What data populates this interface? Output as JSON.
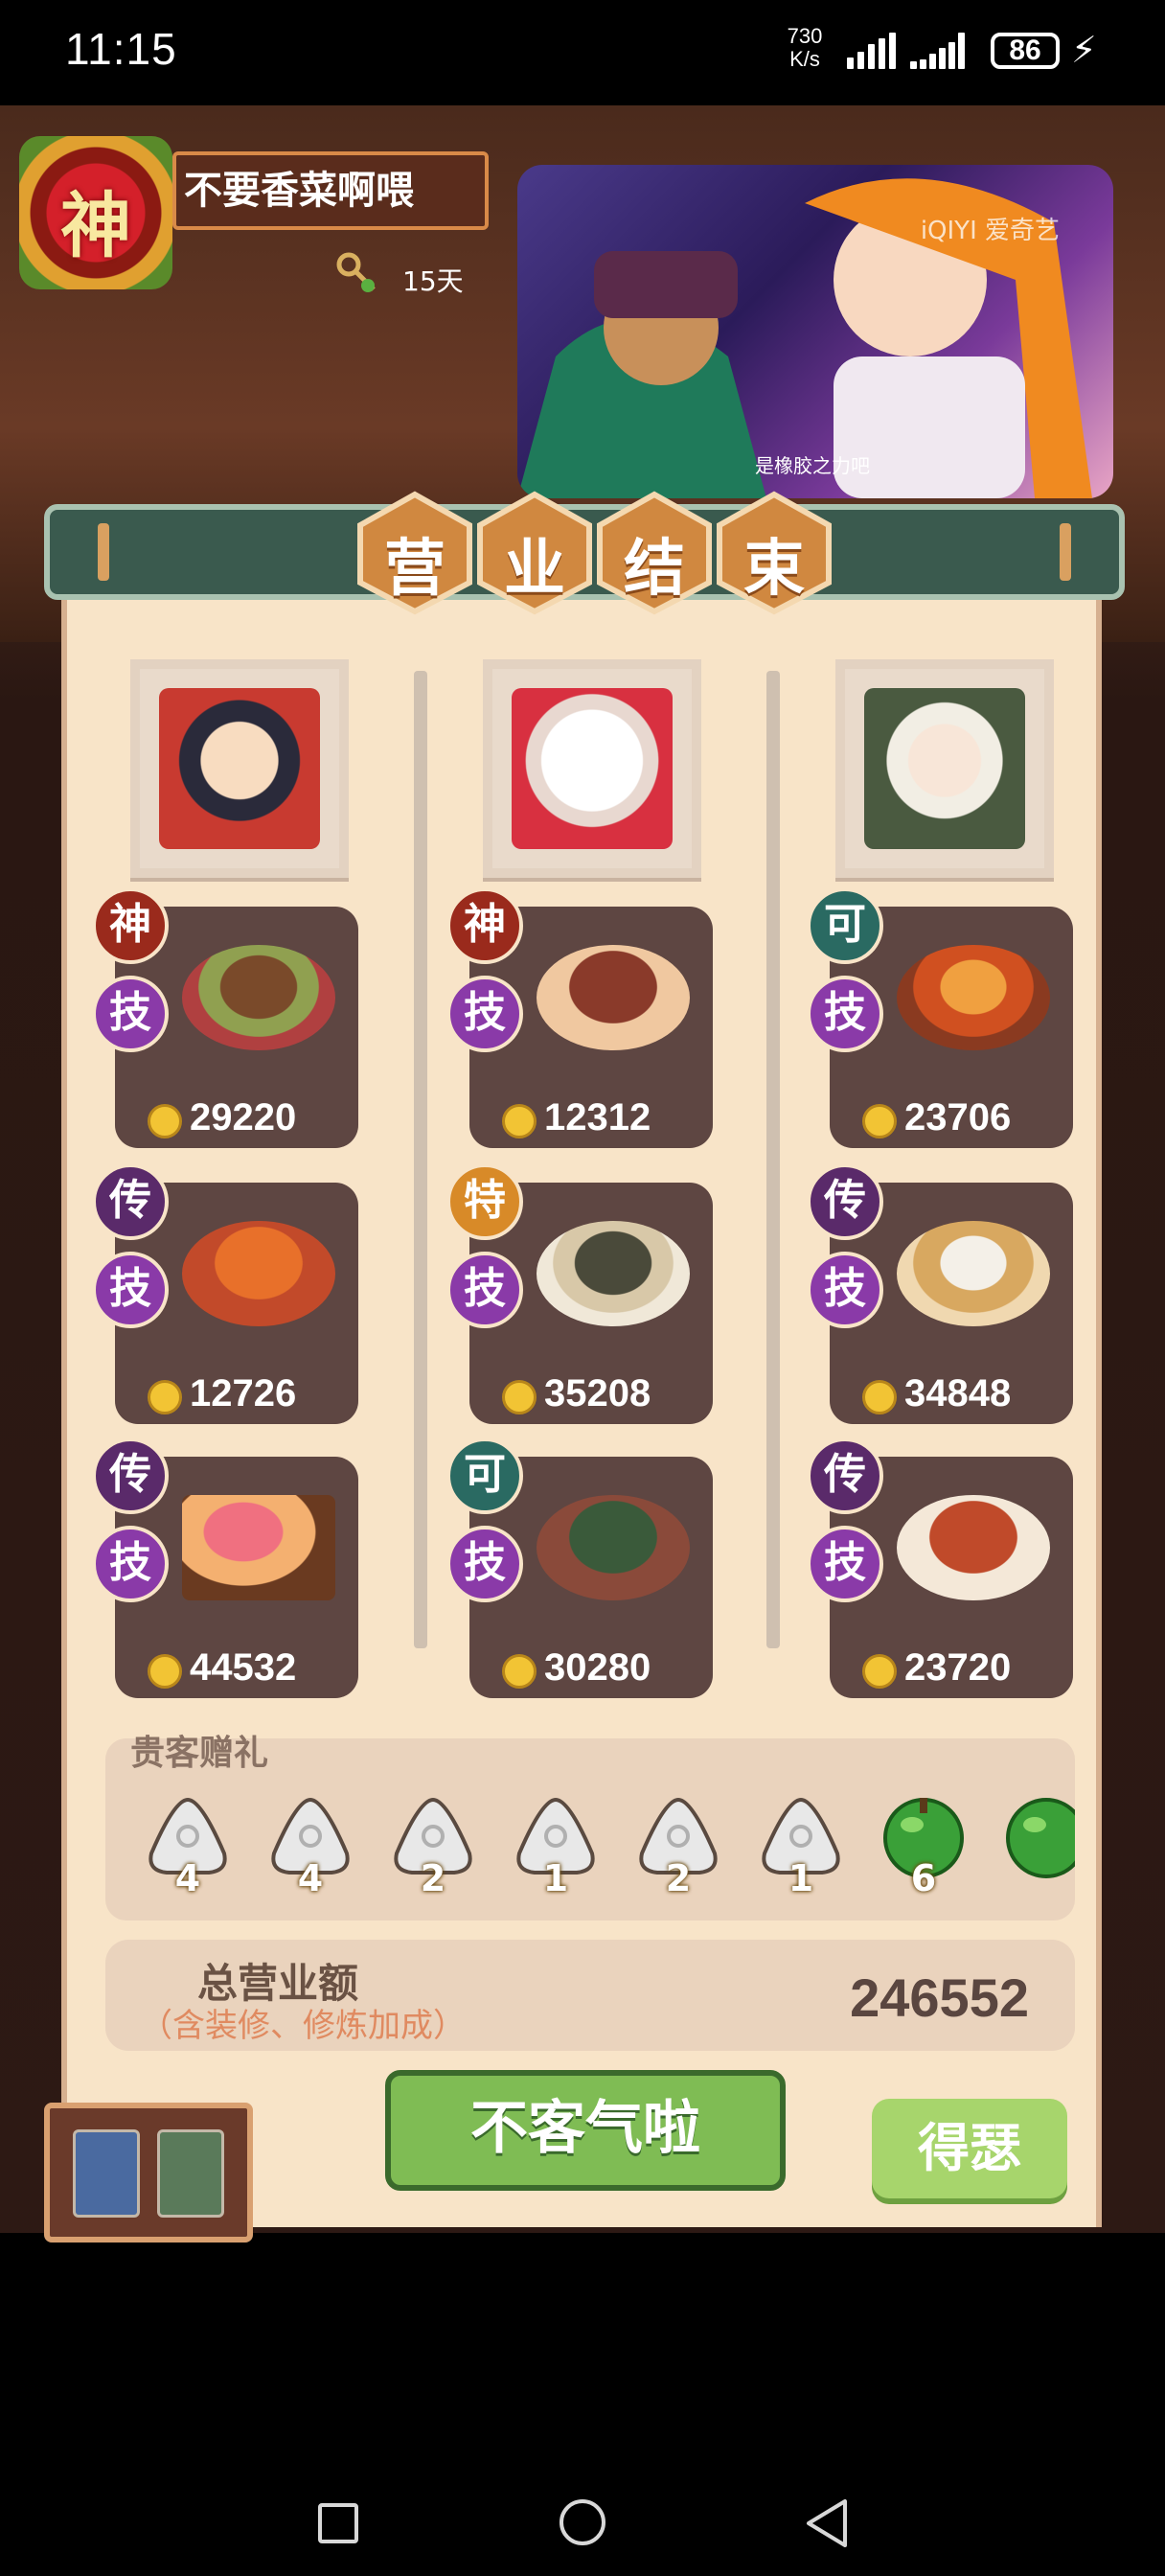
{
  "status_bar": {
    "time": "11:15",
    "net_speed_value": "730",
    "net_speed_unit": "K/s",
    "battery": "86"
  },
  "player": {
    "rank_badge": "神",
    "name": "不要香菜啊喂",
    "days": "15天"
  },
  "video": {
    "watermark": "iQIYI 爱奇艺",
    "subtitle": "是橡胶之力吧"
  },
  "banner": {
    "chars": [
      "营",
      "业",
      "结",
      "束"
    ]
  },
  "guests": [
    {
      "icon": "chef-boy-portrait",
      "dishes": [
        {
          "grade": "神",
          "skill": "技",
          "coins": "29220"
        },
        {
          "grade": "传",
          "skill": "技",
          "coins": "12726"
        },
        {
          "grade": "传",
          "skill": "技",
          "coins": "44532"
        }
      ]
    },
    {
      "icon": "hello-kitty-portrait",
      "dishes": [
        {
          "grade": "神",
          "skill": "技",
          "coins": "12312"
        },
        {
          "grade": "特",
          "skill": "技",
          "coins": "35208"
        },
        {
          "grade": "可",
          "skill": "技",
          "coins": "30280"
        }
      ]
    },
    {
      "icon": "sheep-girl-portrait",
      "dishes": [
        {
          "grade": "可",
          "skill": "技",
          "coins": "23706"
        },
        {
          "grade": "传",
          "skill": "技",
          "coins": "34848"
        },
        {
          "grade": "传",
          "skill": "技",
          "coins": "23720"
        }
      ]
    }
  ],
  "gifts": {
    "label": "贵客赠礼",
    "items": [
      {
        "icon": "rice-ball-icon",
        "count": "4"
      },
      {
        "icon": "rice-ball-icon",
        "count": "4"
      },
      {
        "icon": "rice-ball-icon",
        "count": "2"
      },
      {
        "icon": "rice-ball-icon",
        "count": "1"
      },
      {
        "icon": "rice-ball-icon",
        "count": "2"
      },
      {
        "icon": "rice-ball-icon",
        "count": "1"
      },
      {
        "icon": "green-orb-icon",
        "count": "6"
      },
      {
        "icon": "green-orb-icon",
        "count": ""
      }
    ]
  },
  "total": {
    "label": "总营业额",
    "sub": "（含装修、修炼加成）",
    "value": "246552"
  },
  "buttons": {
    "confirm": "不客气啦",
    "double": "得瑟"
  },
  "colors": {
    "panel": "#f8e4c8",
    "dish_card": "#5e4642",
    "confirm_btn": "#7fbc54",
    "banner": "#3a5a4e"
  }
}
